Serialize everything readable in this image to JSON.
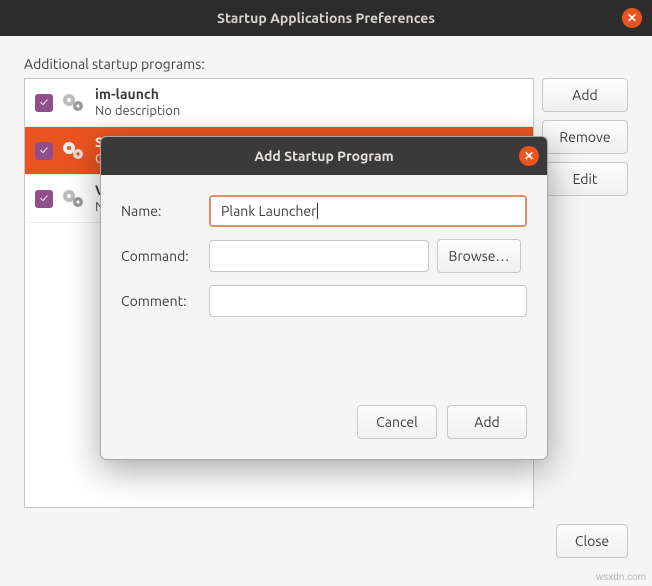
{
  "window": {
    "title": "Startup Applications Preferences",
    "section_label": "Additional startup programs:",
    "close_btn": "Close"
  },
  "buttons": {
    "add": "Add",
    "remove": "Remove",
    "edit": "Edit"
  },
  "items": [
    {
      "title": "im-launch",
      "desc": "No description",
      "checked": true,
      "selected": false
    },
    {
      "title": "SSH",
      "desc": "GN",
      "checked": true,
      "selected": true
    },
    {
      "title": "VM",
      "desc": "No",
      "checked": true,
      "selected": false
    }
  ],
  "modal": {
    "title": "Add Startup Program",
    "labels": {
      "name": "Name:",
      "command": "Command:",
      "comment": "Comment:"
    },
    "name_value": "Plank Launcher",
    "command_value": "",
    "comment_value": "",
    "browse": "Browse…",
    "cancel": "Cancel",
    "add": "Add"
  },
  "watermark": "wsxdn.com"
}
